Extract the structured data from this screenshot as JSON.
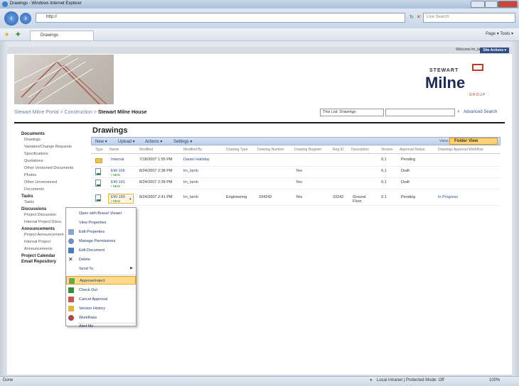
{
  "window": {
    "title": "Drawings - Windows Internet Explorer"
  },
  "browser": {
    "address": "http://",
    "search_placeholder": "Live Search",
    "tab_label": "Drawings",
    "commands": "Page ▾  Tools ▾"
  },
  "site": {
    "welcome": "Welcome lm_lamb ▾",
    "site_actions": "Site Actions ▾",
    "logo_top": "STEWART",
    "logo_main": "Milne",
    "logo_sub": "GROUP"
  },
  "breadcrumb": {
    "parts": "Stewart Milne Portal > Construction > ",
    "current": "Stewart Milne House"
  },
  "search": {
    "scope": "This List: Drawings",
    "advanced": "Advanced Search"
  },
  "quicklaunch": {
    "documents": "Documents",
    "doc_items": [
      "Drawings",
      "Variation/Change Requests",
      "Specifications",
      "Quotations",
      "Other Versioned Documents",
      "Photos",
      "Other Unversioned",
      "Documents"
    ],
    "tasks": "Tasks",
    "task_items": [
      "Tasks"
    ],
    "discussions": "Discussions",
    "disc_items": [
      "Project Discussion",
      "Internal Project Discu"
    ],
    "announcements": "Announcements",
    "ann_items": [
      "Project Announcement",
      "Internal Project",
      "Announcements"
    ],
    "calendar": "Project Calendar",
    "email": "Email Repository"
  },
  "main": {
    "title": "Drawings",
    "toolbar": {
      "new": "New ▾",
      "upload": "Upload ▾",
      "actions": "Actions ▾",
      "settings": "Settings ▾",
      "view_label": "View:",
      "view": "Folder View"
    },
    "columns": [
      "Type",
      "Name",
      "Modified",
      "Modified By",
      "Drawing Type",
      "Drawing Number",
      "Drawing Register",
      "Reg ID",
      "Description",
      "Version",
      "Approval Status",
      "Drawings Approval Workflow"
    ],
    "rows": [
      {
        "name": "Internal",
        "new": "",
        "modified": "7/18/2007 1:55 PM",
        "by": "Daniel Halliday",
        "dtype": "",
        "dnum": "",
        "reg": "",
        "regid": "",
        "desc": "",
        "ver": "0.1",
        "status": "Pending",
        "wf": ""
      },
      {
        "name": "EW-166",
        "new": "! NEW",
        "modified": "8/24/2007 2:38 PM",
        "by": "lm_lamb",
        "dtype": "",
        "dnum": "",
        "reg": "Yes",
        "regid": "",
        "desc": "",
        "ver": "0.1",
        "status": "Draft",
        "wf": ""
      },
      {
        "name": "EW-191",
        "new": "! NEW",
        "modified": "8/24/2007 2:39 PM",
        "by": "lm_lamb",
        "dtype": "",
        "dnum": "",
        "reg": "Yes",
        "regid": "",
        "desc": "",
        "ver": "0.1",
        "status": "Draft",
        "wf": ""
      },
      {
        "name": "EW-189",
        "new": "! NEW",
        "modified": "8/24/2007 2:41 PM",
        "by": "lm_lamb",
        "dtype": "Engineering",
        "dnum": "334242",
        "reg": "Yes",
        "regid": "33242",
        "desc": "Ground Floor",
        "ver": "0.1",
        "status": "Pending",
        "wf": "In Progress"
      }
    ]
  },
  "context_menu": [
    {
      "label": "Open with Brava! Viewer",
      "icon": ""
    },
    {
      "label": "View Properties",
      "icon": ""
    },
    {
      "label": "Edit Properties",
      "icon": "edit-properties-icon"
    },
    {
      "label": "Manage Permissions",
      "icon": "permissions-icon"
    },
    {
      "label": "Edit Document",
      "icon": "edit-document-icon"
    },
    {
      "label": "Delete",
      "icon": "delete-icon"
    },
    {
      "label": "Send To",
      "icon": ""
    },
    {
      "label": "Approve/reject",
      "icon": "approve-icon"
    },
    {
      "label": "Check Out",
      "icon": "check-out-icon"
    },
    {
      "label": "Cancel Approval",
      "icon": "cancel-approval-icon"
    },
    {
      "label": "Version History",
      "icon": "version-history-icon"
    },
    {
      "label": "Workflows",
      "icon": "workflows-icon"
    },
    {
      "label": "Alert Me",
      "icon": ""
    }
  ],
  "status": {
    "text": "Done",
    "zone": "Local intranet | Protected Mode: Off",
    "zoom": "100%"
  },
  "colors": {
    "accent": "#2e4f87",
    "highlight": "#ffd98a",
    "brand_red": "#c03a2b"
  }
}
